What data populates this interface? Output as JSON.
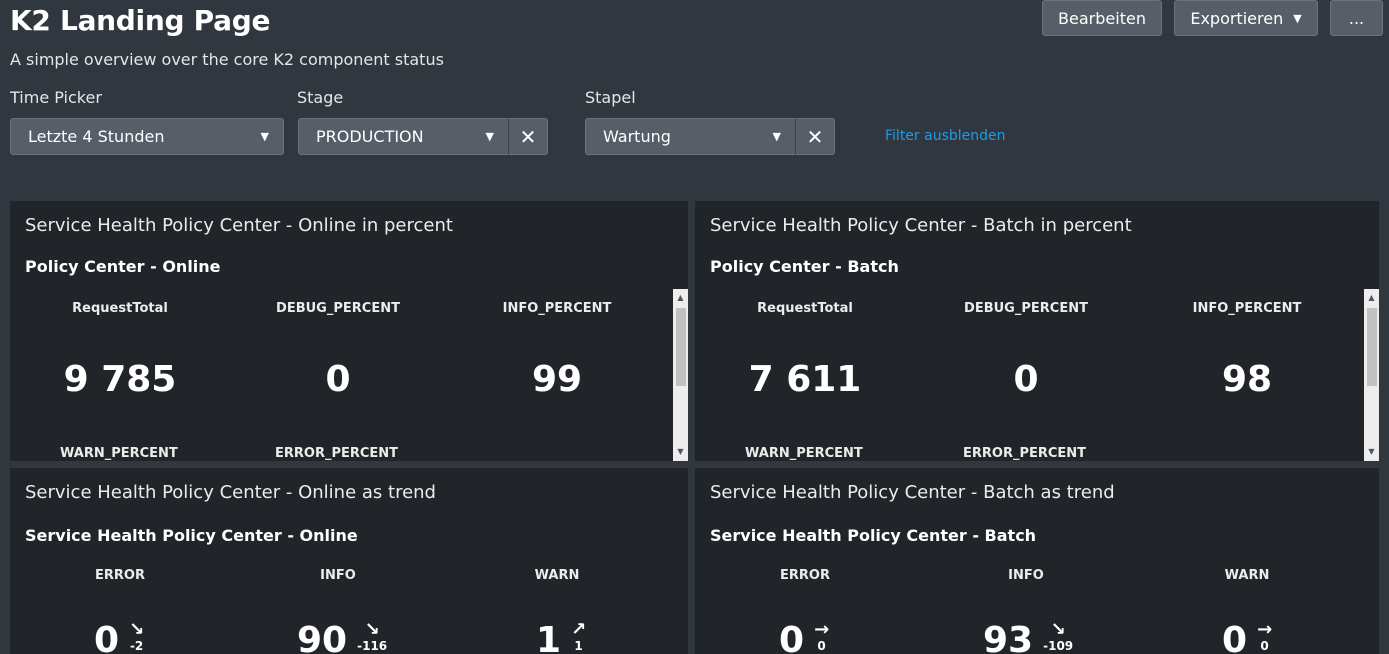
{
  "header": {
    "title": "K2 Landing Page",
    "subtitle": "A simple overview over the core K2 component status",
    "edit_label": "Bearbeiten",
    "export_label": "Exportieren",
    "more_label": "..."
  },
  "filters": {
    "time_picker": {
      "label": "Time Picker",
      "value": "Letzte 4 Stunden"
    },
    "stage": {
      "label": "Stage",
      "value": "PRODUCTION"
    },
    "stapel": {
      "label": "Stapel",
      "value": "Wartung"
    },
    "hide_label": "Filter ausblenden"
  },
  "panels": {
    "online_pct": {
      "title": "Service Health Policy Center - Online in percent",
      "subtitle": "Policy Center - Online",
      "metrics": [
        {
          "label": "RequestTotal",
          "value": "9 785"
        },
        {
          "label": "DEBUG_PERCENT",
          "value": "0"
        },
        {
          "label": "INFO_PERCENT",
          "value": "99"
        }
      ],
      "cut_labels": [
        "WARN_PERCENT",
        "ERROR_PERCENT"
      ]
    },
    "batch_pct": {
      "title": "Service Health Policy Center - Batch in percent",
      "subtitle": "Policy Center - Batch",
      "metrics": [
        {
          "label": "RequestTotal",
          "value": "7 611"
        },
        {
          "label": "DEBUG_PERCENT",
          "value": "0"
        },
        {
          "label": "INFO_PERCENT",
          "value": "98"
        }
      ],
      "cut_labels": [
        "WARN_PERCENT",
        "ERROR_PERCENT"
      ]
    },
    "online_trend": {
      "title": "Service Health Policy Center - Online as trend",
      "subtitle": "Service Health Policy Center - Online",
      "metrics": [
        {
          "label": "ERROR",
          "value": "0",
          "arrow": "↘",
          "delta": "-2"
        },
        {
          "label": "INFO",
          "value": "90",
          "arrow": "↘",
          "delta": "-116"
        },
        {
          "label": "WARN",
          "value": "1",
          "arrow": "↗",
          "delta": "1"
        }
      ]
    },
    "batch_trend": {
      "title": "Service Health Policy Center - Batch as trend",
      "subtitle": "Service Health Policy Center - Batch",
      "metrics": [
        {
          "label": "ERROR",
          "value": "0",
          "arrow": "→",
          "delta": "0"
        },
        {
          "label": "INFO",
          "value": "93",
          "arrow": "↘",
          "delta": "-109"
        },
        {
          "label": "WARN",
          "value": "0",
          "arrow": "→",
          "delta": "0"
        }
      ]
    }
  },
  "colors": {
    "background": "#31373e",
    "panel": "#212529",
    "link": "#1a9cec",
    "control": "#575e67"
  }
}
